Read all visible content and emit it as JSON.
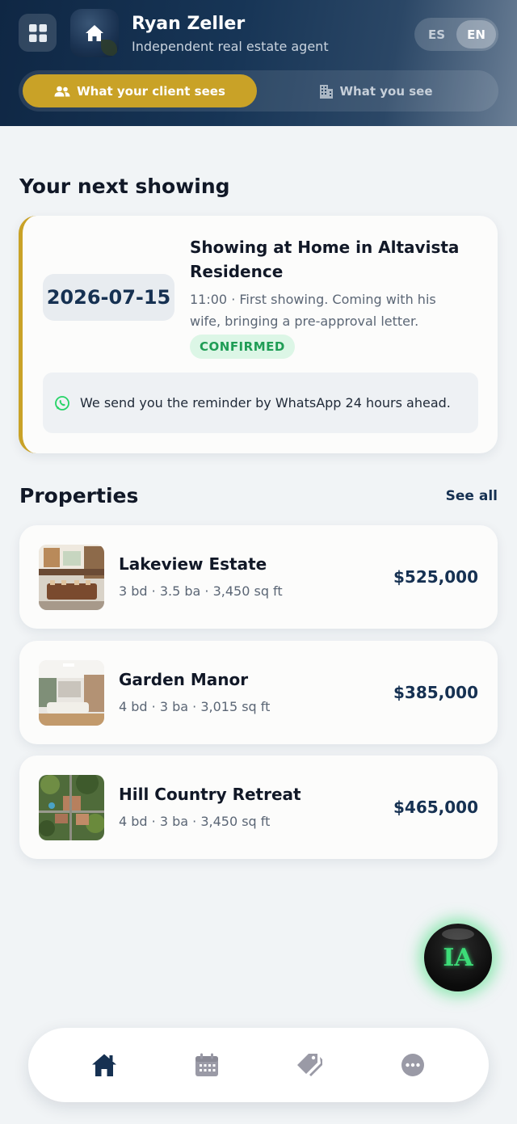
{
  "header": {
    "agent_name": "Ryan Zeller",
    "agent_subtitle": "Independent real estate agent",
    "languages": [
      "ES",
      "EN"
    ],
    "active_language": "EN",
    "view_tabs": [
      {
        "label": "What your client sees",
        "icon": "users-icon",
        "active": true
      },
      {
        "label": "What you see",
        "icon": "building-icon",
        "active": false
      }
    ]
  },
  "next_showing": {
    "section_title": "Your next showing",
    "date": "2026-07-15",
    "title": "Showing at Home in Altavista Residence",
    "description": "11:00 · First showing. Coming with his wife, bringing a pre-approval letter.",
    "status": "CONFIRMED",
    "reminder": "We send you the reminder by WhatsApp 24 hours ahead."
  },
  "properties": {
    "section_title": "Properties",
    "see_all_label": "See all",
    "items": [
      {
        "name": "Lakeview Estate",
        "meta": "3 bd · 3.5 ba · 3,450 sq ft",
        "price": "$525,000"
      },
      {
        "name": "Garden Manor",
        "meta": "4 bd · 3 ba · 3,015 sq ft",
        "price": "$385,000"
      },
      {
        "name": "Hill Country Retreat",
        "meta": "4 bd · 3 ba · 3,450 sq ft",
        "price": "$465,000"
      }
    ]
  },
  "assistant": {
    "label": "IA"
  },
  "bottom_nav": [
    {
      "icon": "home-icon",
      "active": true
    },
    {
      "icon": "calendar-icon",
      "active": false
    },
    {
      "icon": "tag-icon",
      "active": false
    },
    {
      "icon": "more-icon",
      "active": false
    }
  ],
  "colors": {
    "accent_gold": "#c9a227",
    "navy": "#163152",
    "confirmed_green": "#1f9d55",
    "whatsapp_green": "#25d366",
    "ai_glow": "#3ddc78"
  }
}
